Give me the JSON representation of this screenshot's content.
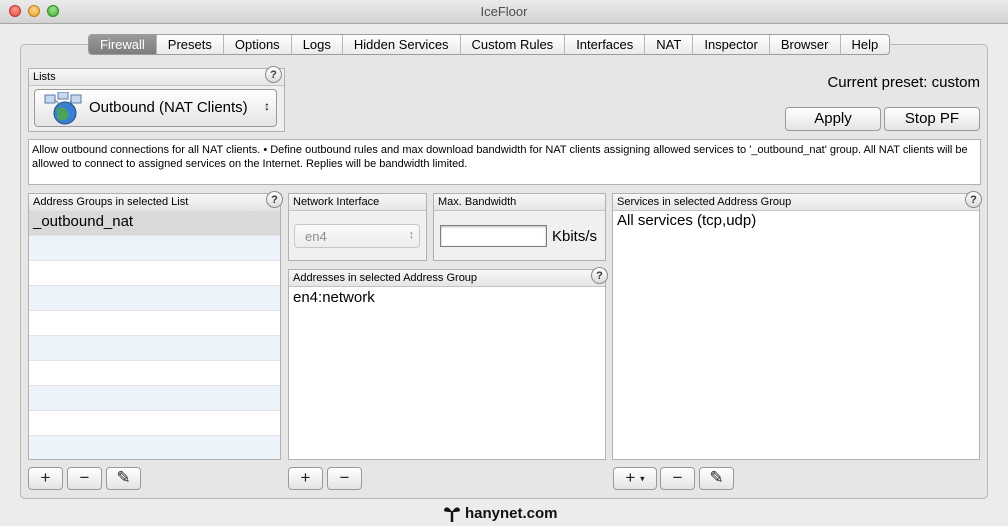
{
  "window": {
    "title": "IceFloor"
  },
  "tabs": [
    "Firewall",
    "Presets",
    "Options",
    "Logs",
    "Hidden Services",
    "Custom Rules",
    "Interfaces",
    "NAT",
    "Inspector",
    "Browser",
    "Help"
  ],
  "lists": {
    "label": "Lists",
    "selected": "Outbound (NAT Clients)"
  },
  "preset": {
    "label": "Current preset: custom"
  },
  "buttons": {
    "apply": "Apply",
    "stop": "Stop PF"
  },
  "description": "Allow outbound connections for all NAT clients. • Define outbound rules and max download bandwidth for NAT clients assigning allowed services to '_outbound_nat' group. All NAT clients will be allowed to connect to assigned services on the Internet. Replies will be bandwidth limited.",
  "address_groups": {
    "header": "Address Groups in selected List",
    "items": [
      "_outbound_nat"
    ]
  },
  "network_interface": {
    "header": "Network Interface",
    "value": "en4"
  },
  "bandwidth": {
    "header": "Max. Bandwidth",
    "value": "",
    "unit": "Kbits/s"
  },
  "addresses": {
    "header": "Addresses in selected Address Group",
    "items": [
      "en4:network"
    ]
  },
  "services": {
    "header": "Services in selected Address Group",
    "items": [
      "All services (tcp,udp)"
    ]
  },
  "help_glyph": "?",
  "footer": {
    "brand": "hanynet.com"
  },
  "icons": {
    "add": "+",
    "remove": "−",
    "edit": "✎",
    "popup": "↕",
    "dropdown": "▾"
  }
}
